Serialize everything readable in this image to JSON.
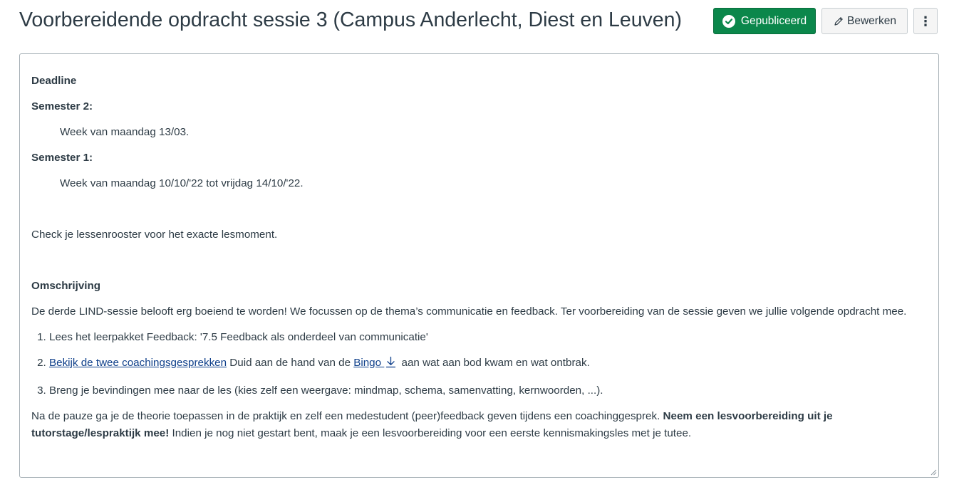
{
  "header": {
    "title": "Voorbereidende opdracht sessie 3 (Campus Anderlecht, Diest en Leuven)",
    "published_label": "Gepubliceerd",
    "edit_label": "Bewerken",
    "more_glyph": "⋮"
  },
  "content": {
    "deadline_heading": "Deadline",
    "semester2_label": "Semester 2:",
    "semester2_date": "Week van maandag 13/03.",
    "semester1_label": "Semester 1:",
    "semester1_date": "Week van maandag 10/10/'22 tot vrijdag 14/10/'22.",
    "check_text": "Check je lessenrooster voor het exacte lesmoment.",
    "description_heading": "Omschrijving",
    "intro_text": "De derde LIND-sessie belooft erg boeiend te worden! We focussen op de thema’s communicatie en feedback. Ter voorbereiding van de sessie geven we jullie volgende opdracht mee.",
    "list": {
      "item1": "Lees het leerpakket Feedback: '7.5 Feedback als onderdeel van communicatie'",
      "item2_link": "Bekijk de twee coachingsgesprekken",
      "item2_mid": " Duid aan de hand van de ",
      "item2_bingo": "Bingo ",
      "item2_end": " aan wat aan bod kwam en wat ontbrak.",
      "item3": "Breng je bevindingen mee naar de les (kies zelf een weergave: mindmap, schema, samenvatting, kernwoorden, ...)."
    },
    "closing_text": "Na de pauze ga je de theorie toepassen in de praktijk en zelf een medestudent (peer)feedback geven tijdens een coachinggesprek. ",
    "closing_bold": "Neem een lesvoorbereiding uit je tutorstage/lespraktijk mee!",
    "closing_end": " Indien je nog niet gestart bent, maak je een lesvoorbereiding voor een eerste kennismakingsles met je tutee."
  },
  "colors": {
    "published_green": "#0b874b",
    "link_blue": "#0e3f8a",
    "text": "#2d3b45"
  },
  "icons": {
    "published": "check-circle-icon",
    "edit": "pencil-icon",
    "more": "kebab-menu-icon",
    "download": "download-icon"
  }
}
